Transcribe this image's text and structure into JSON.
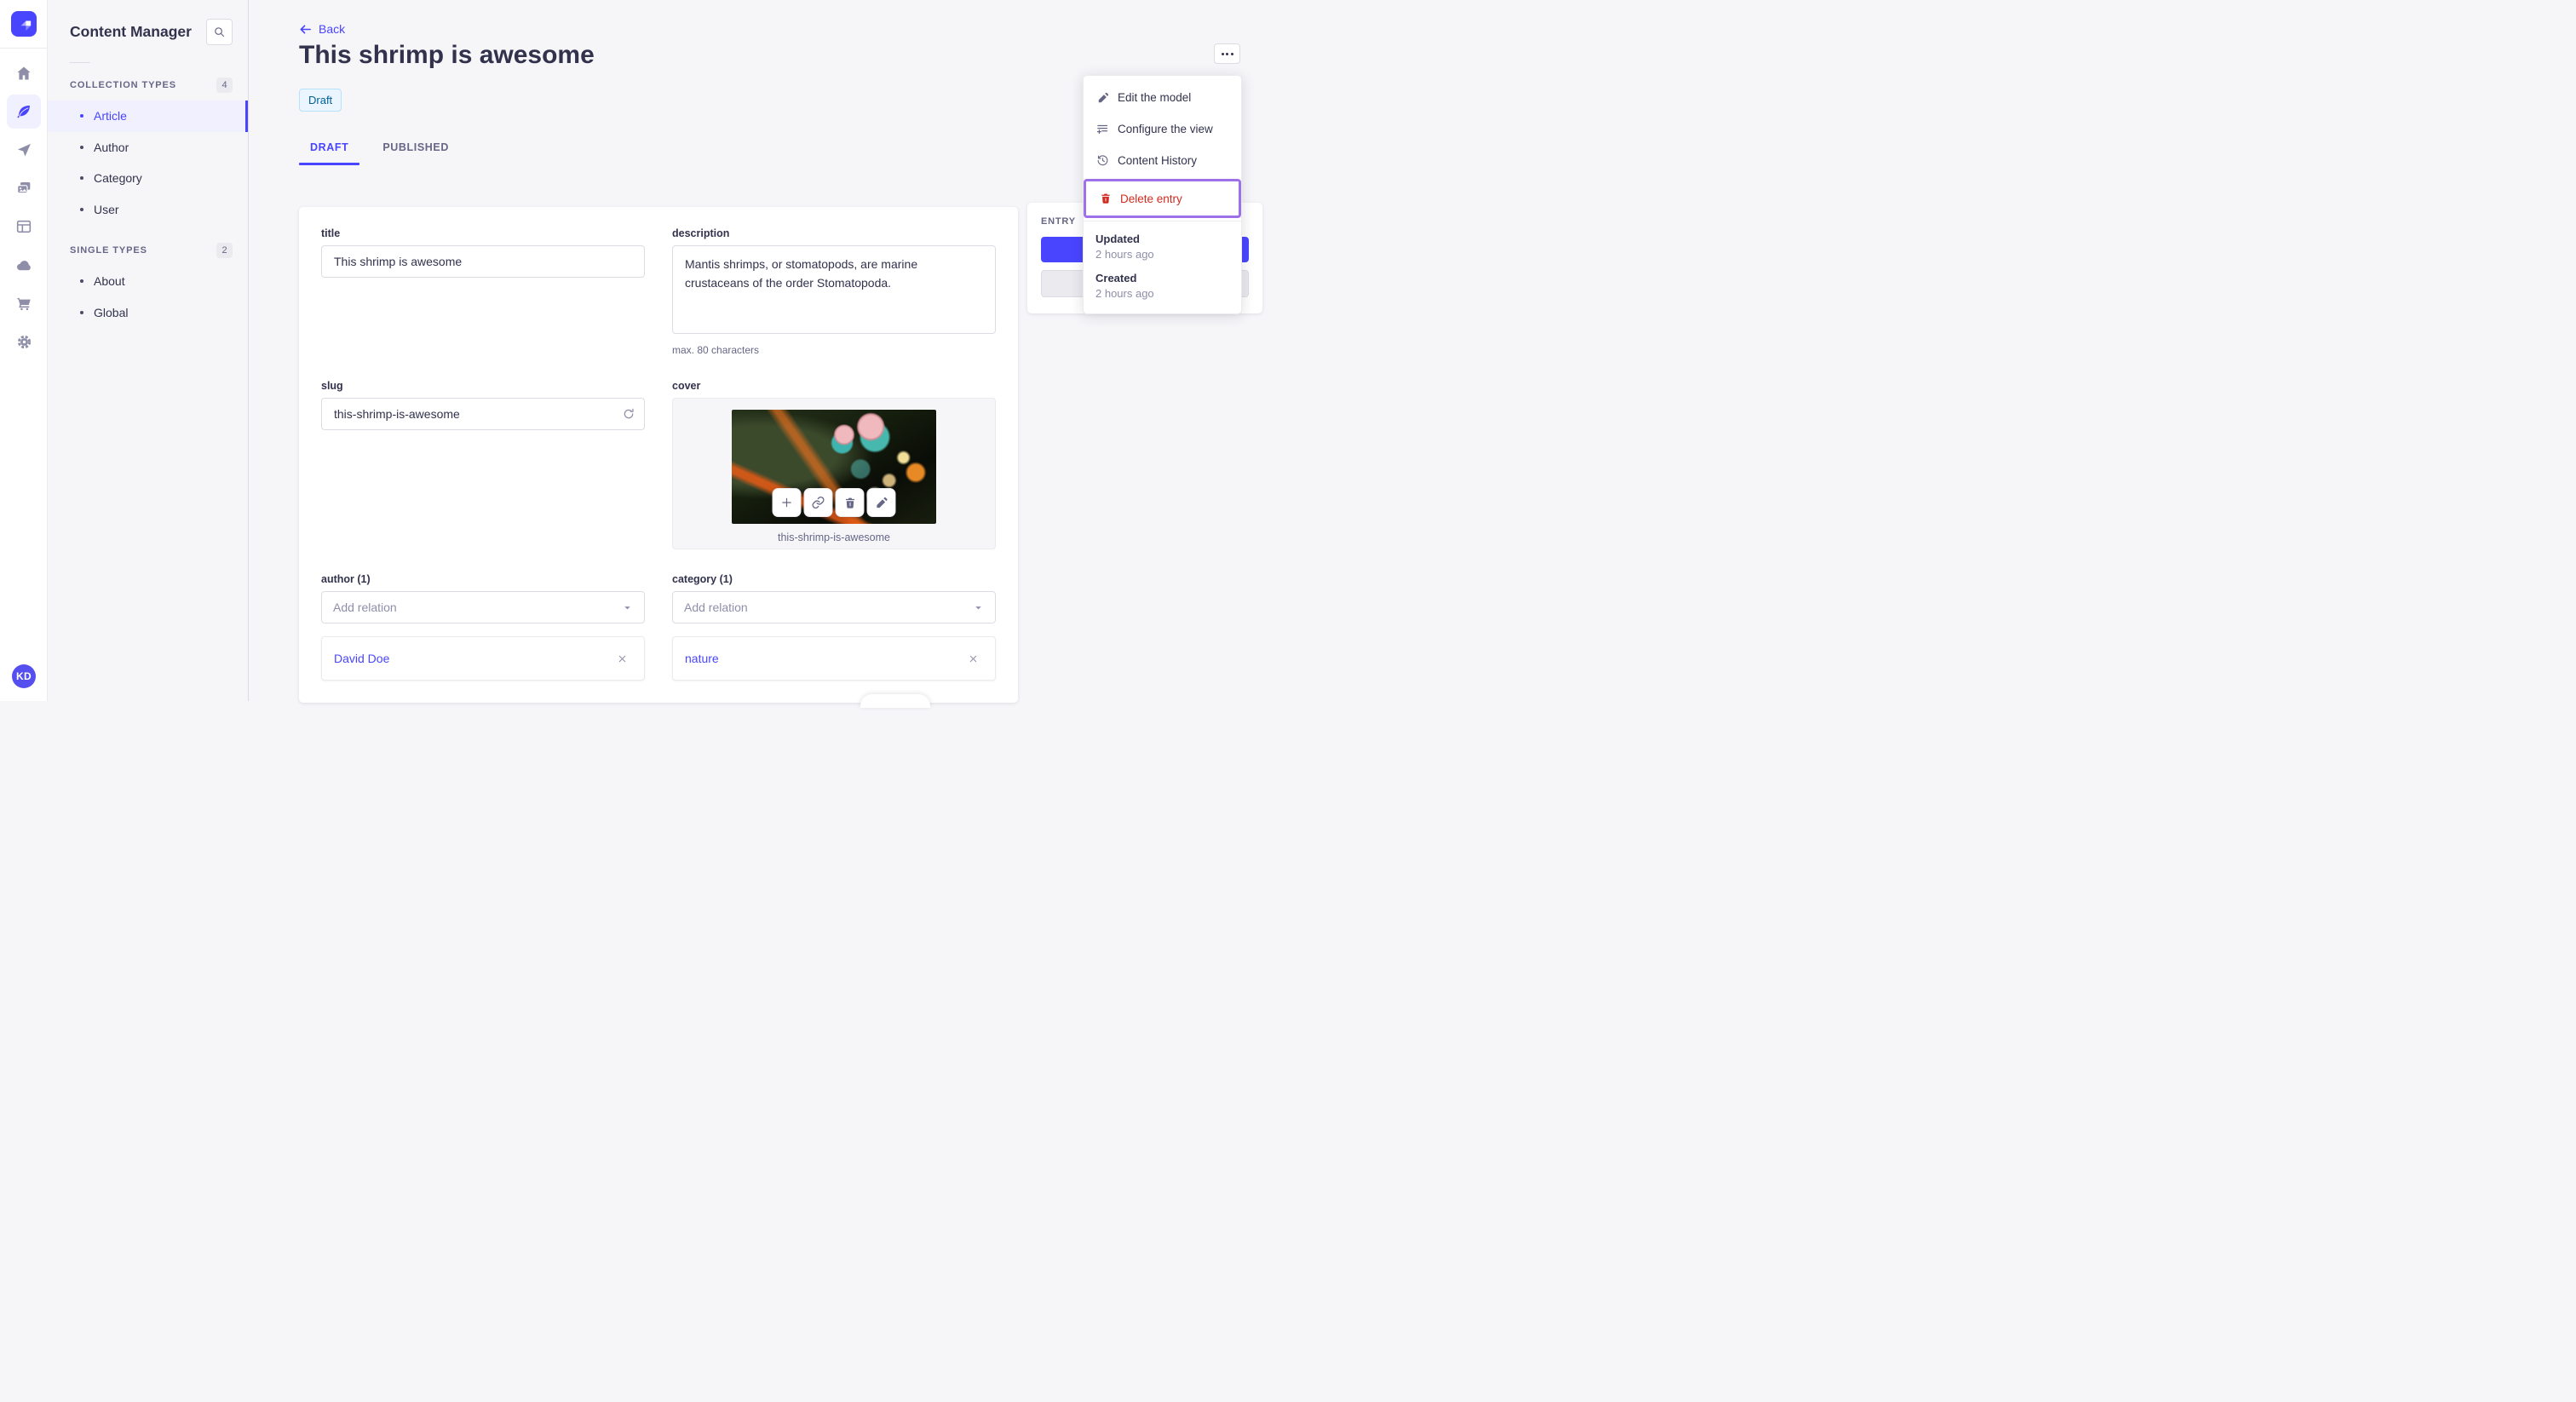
{
  "user": {
    "initials": "KD"
  },
  "rail": {
    "icons": [
      "strapi-logo",
      "home",
      "content-manager-feather",
      "releases-plane",
      "media-library-images",
      "content-type-builder-layout",
      "deploy-cloud",
      "marketplace-cart",
      "settings-gear"
    ],
    "active_icon": "content-manager-feather"
  },
  "subnav": {
    "title": "Content Manager",
    "sections": [
      {
        "label": "COLLECTION TYPES",
        "count": "4",
        "items": [
          {
            "label": "Article",
            "active": true
          },
          {
            "label": "Author"
          },
          {
            "label": "Category"
          },
          {
            "label": "User"
          }
        ]
      },
      {
        "label": "SINGLE TYPES",
        "count": "2",
        "items": [
          {
            "label": "About"
          },
          {
            "label": "Global"
          }
        ]
      }
    ]
  },
  "header": {
    "back_label": "Back",
    "title": "This shrimp is awesome",
    "status_badge": "Draft",
    "tabs": [
      {
        "label": "DRAFT",
        "active": true
      },
      {
        "label": "PUBLISHED"
      }
    ]
  },
  "form": {
    "fields": {
      "title": {
        "label": "title",
        "value": "This shrimp is awesome"
      },
      "description": {
        "label": "description",
        "value": "Mantis shrimps, or stomatopods, are marine crustaceans of the order Stomatopoda.",
        "helper": "max. 80 characters"
      },
      "slug": {
        "label": "slug",
        "value": "this-shrimp-is-awesome"
      },
      "cover": {
        "label": "cover",
        "caption": "this-shrimp-is-awesome",
        "actions": [
          "add",
          "copy-link",
          "delete",
          "edit"
        ]
      },
      "author": {
        "label": "author (1)",
        "placeholder": "Add relation",
        "relation": "David Doe"
      },
      "category": {
        "label": "category (1)",
        "placeholder": "Add relation",
        "relation": "nature"
      }
    }
  },
  "entry": {
    "label": "ENTRY"
  },
  "context_menu": {
    "items": [
      {
        "label": "Edit the model",
        "icon": "pencil-icon"
      },
      {
        "label": "Configure the view",
        "icon": "configure-icon"
      },
      {
        "label": "Content History",
        "icon": "history-icon"
      },
      {
        "label": "Delete entry",
        "icon": "trash-icon",
        "danger": true,
        "highlighted": true
      }
    ],
    "meta": [
      {
        "label": "Updated",
        "value": "2 hours ago"
      },
      {
        "label": "Created",
        "value": "2 hours ago"
      }
    ]
  },
  "colors": {
    "accent": "#4945FF",
    "accent_bg": "#F0F0FF",
    "danger": "#D02B20",
    "highlight_outline": "#9E71E8",
    "draft_bg": "#EAF5FF",
    "draft_border": "#B8E1FF",
    "draft_text": "#006096",
    "page_bg": "#F6F6F9"
  }
}
